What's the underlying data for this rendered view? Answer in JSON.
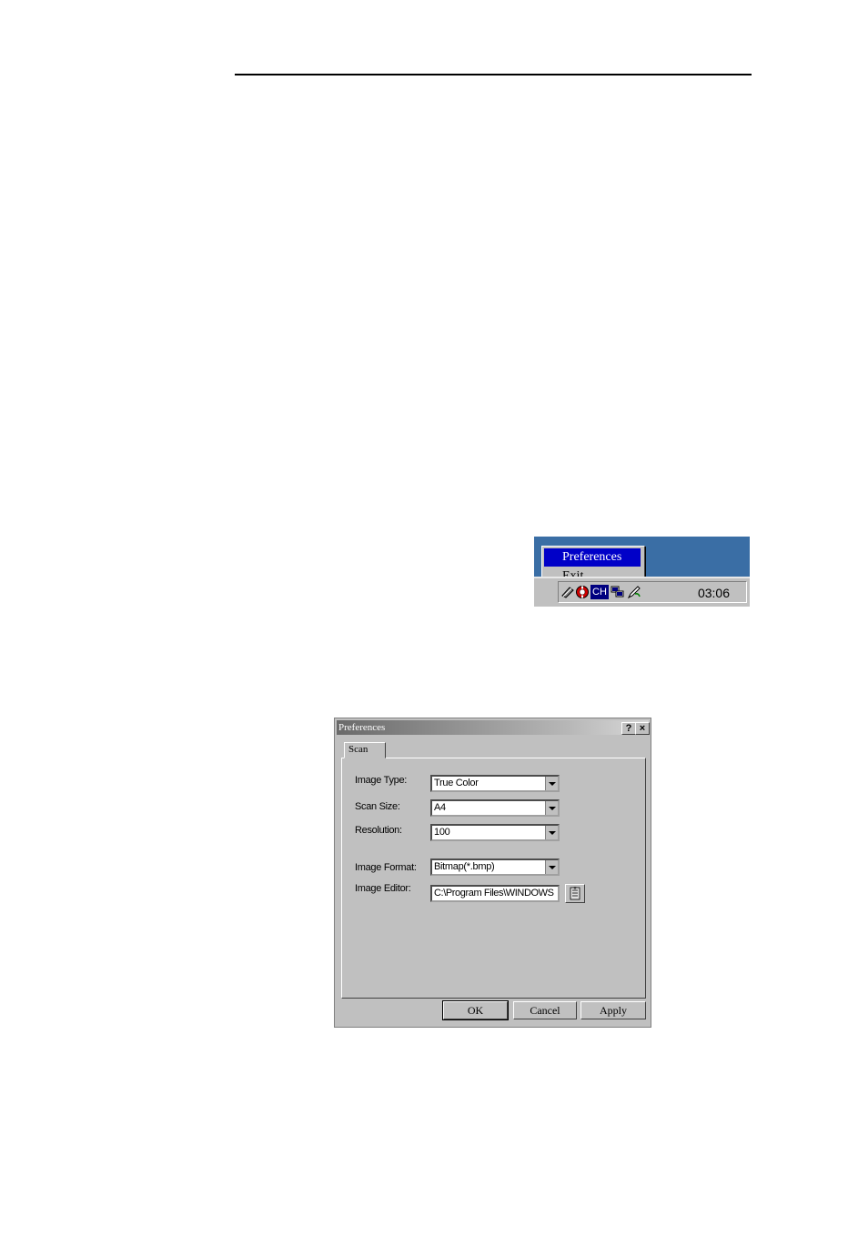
{
  "context_menu": {
    "items": [
      {
        "label": "Preferences",
        "selected": true
      },
      {
        "label": "Exit",
        "selected": false
      }
    ]
  },
  "taskbar": {
    "clock": "03:06",
    "tray_icons": [
      "scanner-icon",
      "lifebuoy-icon",
      "ch-input-icon",
      "network-icon",
      "pen-icon"
    ],
    "ch_label": "CH"
  },
  "dialog": {
    "title": "Preferences",
    "help_glyph": "?",
    "close_glyph": "×",
    "tab": "Scan",
    "fields": {
      "image_type": {
        "label": "Image Type:",
        "value": "True Color"
      },
      "scan_size": {
        "label": "Scan Size:",
        "value": "A4"
      },
      "resolution": {
        "label": "Resolution:",
        "value": "100"
      },
      "image_format": {
        "label": "Image Format:",
        "value": "Bitmap(*.bmp)"
      },
      "image_editor": {
        "label": "Image Editor:",
        "value": "C:\\Program Files\\WINDOWS"
      }
    },
    "buttons": {
      "ok": "OK",
      "cancel": "Cancel",
      "apply": "Apply"
    }
  },
  "colors": {
    "desktop": "#3a6ea5",
    "selection": "#0000c8",
    "face": "#c0c0c0"
  }
}
